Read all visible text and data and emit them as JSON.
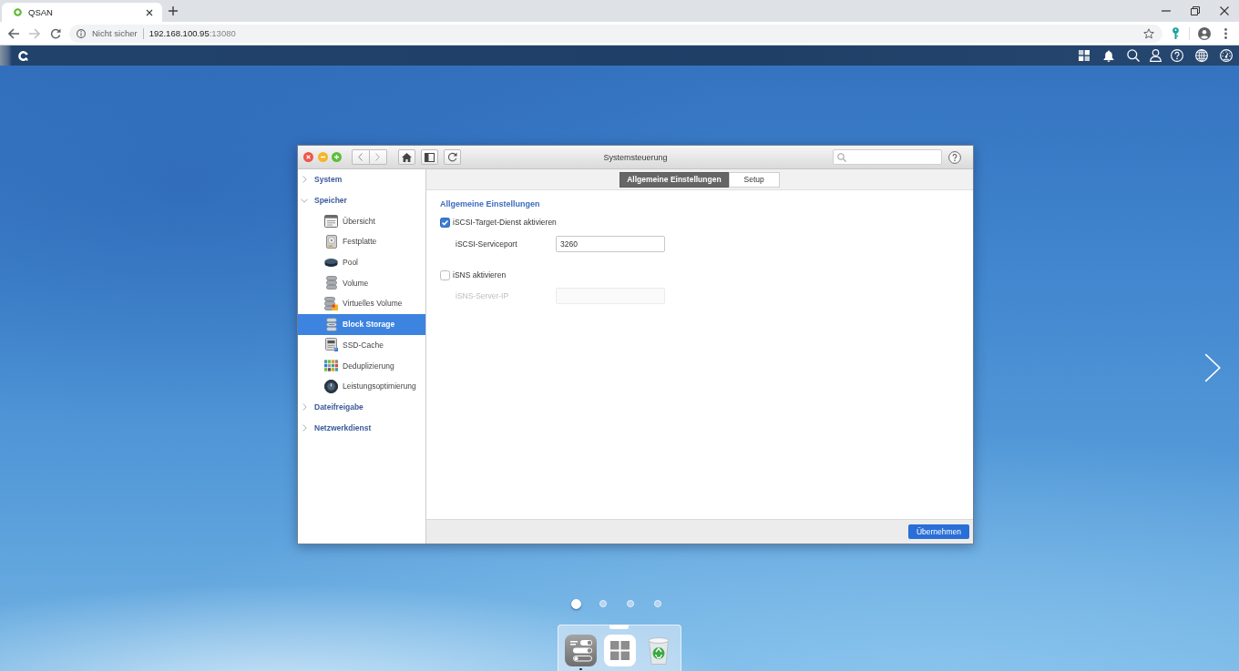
{
  "browser": {
    "tab_title": "QSAN",
    "address": {
      "security": "Nicht sicher",
      "host": "192.168.100.95",
      "port": ":13080"
    }
  },
  "window": {
    "title": "Systemsteuerung"
  },
  "sidebar": {
    "items": [
      {
        "label": "System",
        "expanded": false,
        "selected": false
      },
      {
        "label": "Speicher",
        "expanded": true,
        "selected": false,
        "children": [
          {
            "label": "Übersicht",
            "selected": false
          },
          {
            "label": "Festplatte",
            "selected": false
          },
          {
            "label": "Pool",
            "selected": false
          },
          {
            "label": "Volume",
            "selected": false
          },
          {
            "label": "Virtuelles Volume",
            "selected": false
          },
          {
            "label": "Block Storage",
            "selected": true
          },
          {
            "label": "SSD-Cache",
            "selected": false
          },
          {
            "label": "Deduplizierung",
            "selected": false
          },
          {
            "label": "Leistungsoptimierung",
            "selected": false
          }
        ]
      },
      {
        "label": "Dateifreigabe",
        "expanded": false,
        "selected": false
      },
      {
        "label": "Netzwerkdienst",
        "expanded": false,
        "selected": false
      }
    ]
  },
  "tabs": [
    {
      "label": "Allgemeine Einstellungen",
      "selected": true
    },
    {
      "label": "Setup",
      "selected": false
    }
  ],
  "content": {
    "heading": "Allgemeine Einstellungen",
    "settings": [
      {
        "kind": "checkbox",
        "label": "iSCSI-Target-Dienst aktivieren",
        "checked": true
      },
      {
        "kind": "field",
        "label": "iSCSI-Serviceport",
        "value": "3260",
        "disabled": false
      },
      {
        "kind": "checkbox",
        "label": "iSNS aktivieren",
        "checked": false
      },
      {
        "kind": "field",
        "label": "iSNS-Server-IP",
        "disabled": true
      }
    ]
  },
  "footer": {
    "apply_button": "Übernehmen"
  },
  "desktop": {
    "pages": [
      {
        "selected": true
      },
      {
        "selected": false
      },
      {
        "selected": false
      },
      {
        "selected": false
      }
    ]
  },
  "dock": [
    {
      "running": true
    },
    {
      "running": false
    },
    {
      "running": false
    }
  ]
}
